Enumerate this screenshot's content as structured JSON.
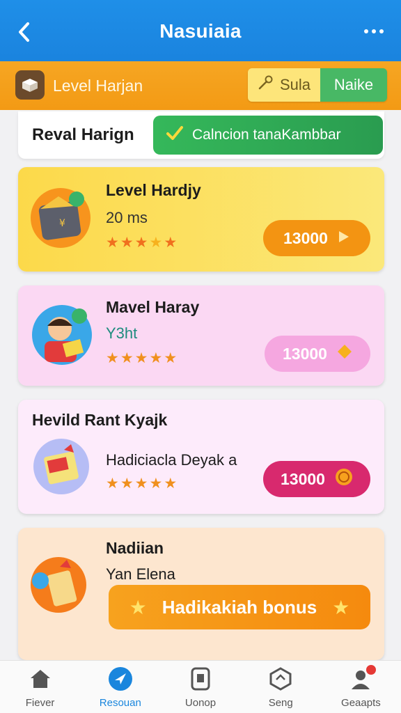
{
  "header": {
    "title": "Nasuiaia",
    "back_icon": "back-arrow-icon",
    "more_icon": "more-dots-icon"
  },
  "level_bar": {
    "label": "Level Harjan",
    "sula_label": "Sula",
    "naike_label": "Naike"
  },
  "tab_strip": {
    "label": "Reval Harign",
    "button_label": "Calncion tanaKambbar"
  },
  "cards": [
    {
      "name": "Level Hardjy",
      "subtitle": "20 ms",
      "rating": 5,
      "price": "13000",
      "colors": {
        "pill": "#f39412"
      }
    },
    {
      "name": "Mavel Haray",
      "subtitle": "Y3ht",
      "rating": 5,
      "price": "13000",
      "colors": {
        "pill": "#f5a7e0"
      }
    },
    {
      "name": "Hevild Rant Kyajk",
      "subtitle": "Hadiciacla Deyak a",
      "rating": 5,
      "price": "13000",
      "colors": {
        "pill": "#d8296e"
      }
    },
    {
      "name": "Nadiian",
      "subtitle": "Yan Elena",
      "bonus_label": "Hadikakiah bonus",
      "colors": {
        "pill": "#f5900e"
      }
    }
  ],
  "bottom_nav": [
    {
      "label": "Fiever",
      "icon": "home-icon",
      "active": false
    },
    {
      "label": "Resouan",
      "icon": "compass-icon",
      "active": true
    },
    {
      "label": "Uonop",
      "icon": "phone-icon",
      "active": false
    },
    {
      "label": "Seng",
      "icon": "shield-icon",
      "active": false
    },
    {
      "label": "Geaapts",
      "icon": "profile-icon",
      "active": false
    }
  ],
  "colors": {
    "primary": "#1f8fe8",
    "orange": "#f6a623",
    "green": "#35b85a"
  }
}
